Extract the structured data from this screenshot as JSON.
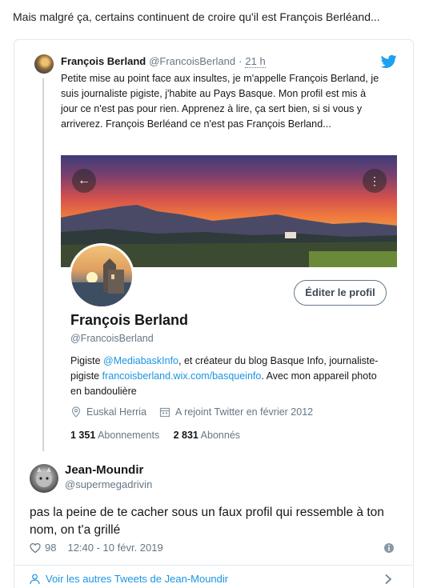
{
  "caption": "Mais malgré ça, certains continuent de croire qu'il est François Berléand...",
  "quoted_tweet": {
    "name": "François Berland",
    "handle": "@FrancoisBerland",
    "separator": "·",
    "time": "21 h",
    "text": "Petite mise au point face aux insultes, je m'appelle François Berland, je suis journaliste pigiste, j'habite au Pays Basque. Mon profil est mis à jour ce n'est pas pour rien. Apprenez à lire, ça sert bien, si si vous y arriverez. François Berléand ce n'est pas François Berland..."
  },
  "profile": {
    "back_glyph": "←",
    "more_glyph": "⋮",
    "edit_label": "Éditer le profil",
    "name": "François Berland",
    "handle": "@FrancoisBerland",
    "bio_1": "Pigiste ",
    "bio_link_1": "@MediabaskInfo",
    "bio_2": ", et créateur du blog Basque Info, journaliste-pigiste ",
    "bio_link_2": "francoisberland.wix.com/basqueinfo",
    "bio_3": ". Avec mon appareil photo en bandoulière",
    "location": "Euskal Herria",
    "joined": "A rejoint Twitter en février 2012",
    "following_count": "1 351",
    "following_label": "Abonnements",
    "followers_count": "2 831",
    "followers_label": "Abonnés"
  },
  "reply": {
    "name": "Jean-Moundir",
    "handle": "@supermegadrivin",
    "text": "pas la peine de te cacher sous un faux profil qui ressemble à ton nom, on t'a grillé",
    "likes": "98",
    "timestamp": "12:40 - 10 févr. 2019",
    "see_more": "Voir les autres Tweets de Jean-Moundir"
  },
  "colors": {
    "link": "#1b95e0",
    "twitter_blue": "#1da1f2",
    "muted": "#657786"
  },
  "icons": [
    "twitter-bird-icon",
    "back-arrow-icon",
    "more-icon",
    "location-icon",
    "calendar-icon",
    "heart-icon",
    "info-icon",
    "user-icon",
    "chevron-right-icon"
  ]
}
